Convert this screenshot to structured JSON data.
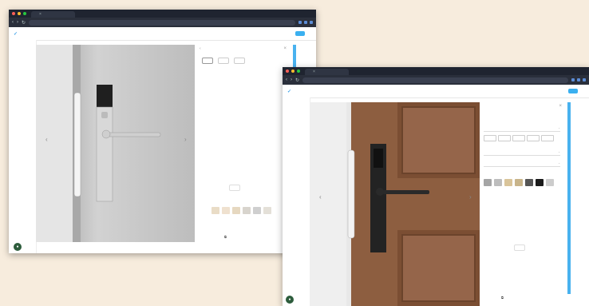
{
  "window1": {
    "tab_title": "",
    "url": "",
    "logo_text": "",
    "nav": {
      "title": "",
      "center": "",
      "right1": "",
      "right2": "",
      "cta": "",
      "lang": ""
    },
    "panel": {
      "title": "",
      "pills": [
        "",
        "",
        ""
      ],
      "info": "",
      "swatches": [
        "#e9dcc6",
        "#efe1cf",
        "#e6d8c0",
        "#d8d4cd",
        "#cfcfcf",
        "#e4e0d8"
      ],
      "bottom_label": "",
      "qty": "",
      "mini": [
        "",
        "",
        "",
        "",
        ""
      ]
    }
  },
  "window2": {
    "tab_title": "",
    "url": "",
    "logo_text": "",
    "nav": {
      "title": "",
      "center": "",
      "right1": "",
      "right2": "",
      "cta": "",
      "lang": ""
    },
    "panel": {
      "title": "",
      "labels": [
        "",
        "",
        ""
      ],
      "fields": [
        "",
        "",
        ""
      ],
      "color_label": "",
      "colors": [
        "#a5a5a5",
        "#bdbdbd",
        "#d9c49a",
        "#c8b48a",
        "#555555",
        "#1a1a1a",
        "#cccccc"
      ],
      "info": "",
      "bottom_label": "",
      "qty": ""
    }
  }
}
